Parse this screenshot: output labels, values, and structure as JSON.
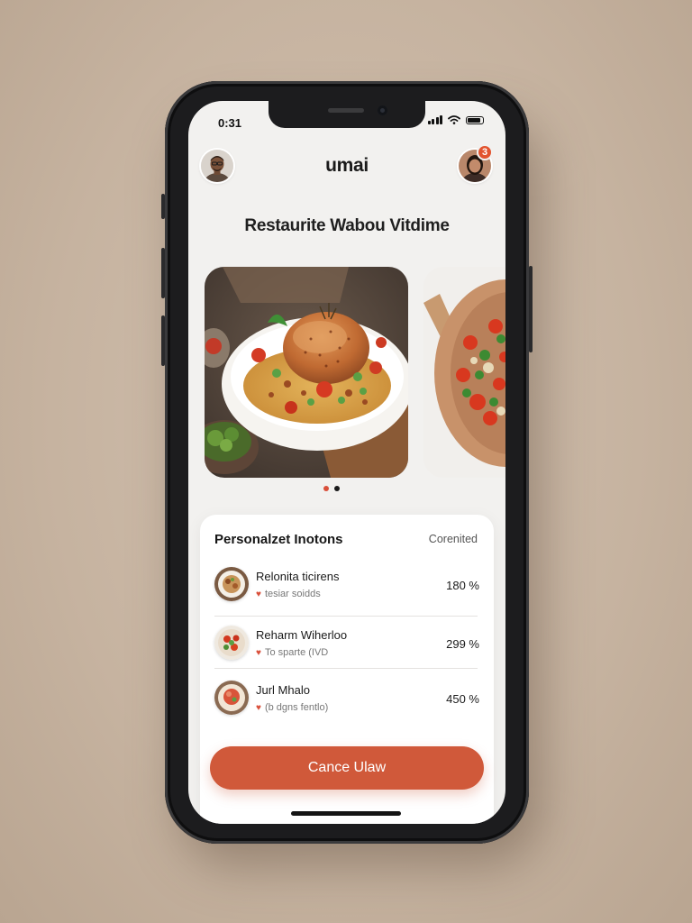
{
  "status_bar": {
    "time": "0:31"
  },
  "header": {
    "app_title": "umai",
    "notification_count": "3"
  },
  "page_heading": "Restaurite Wabou Vitdime",
  "carousel": {
    "active_index": 0,
    "total": 2
  },
  "panel": {
    "title": "Personalzet Inotons",
    "link_label": "Corenited",
    "items": [
      {
        "name": "Relonita ticirens",
        "sub": "tesiar soidds",
        "pct": "180 %"
      },
      {
        "name": "Reharm Wiherloo",
        "sub": "To sparte (IVD",
        "pct": "299 %"
      },
      {
        "name": "Jurl Mhalo",
        "sub": "(b dgns fentlo)",
        "pct": "450 %"
      }
    ]
  },
  "cta_label": "Cance Ulaw",
  "colors": {
    "accent": "#d0593a",
    "badge": "#e2542f",
    "dot_active": "#d94f3a",
    "dot_inactive": "#1a1a1a"
  },
  "icons": [
    "signal-icon",
    "wifi-icon",
    "battery-icon",
    "heart-icon",
    "avatar-user",
    "avatar-profile"
  ]
}
